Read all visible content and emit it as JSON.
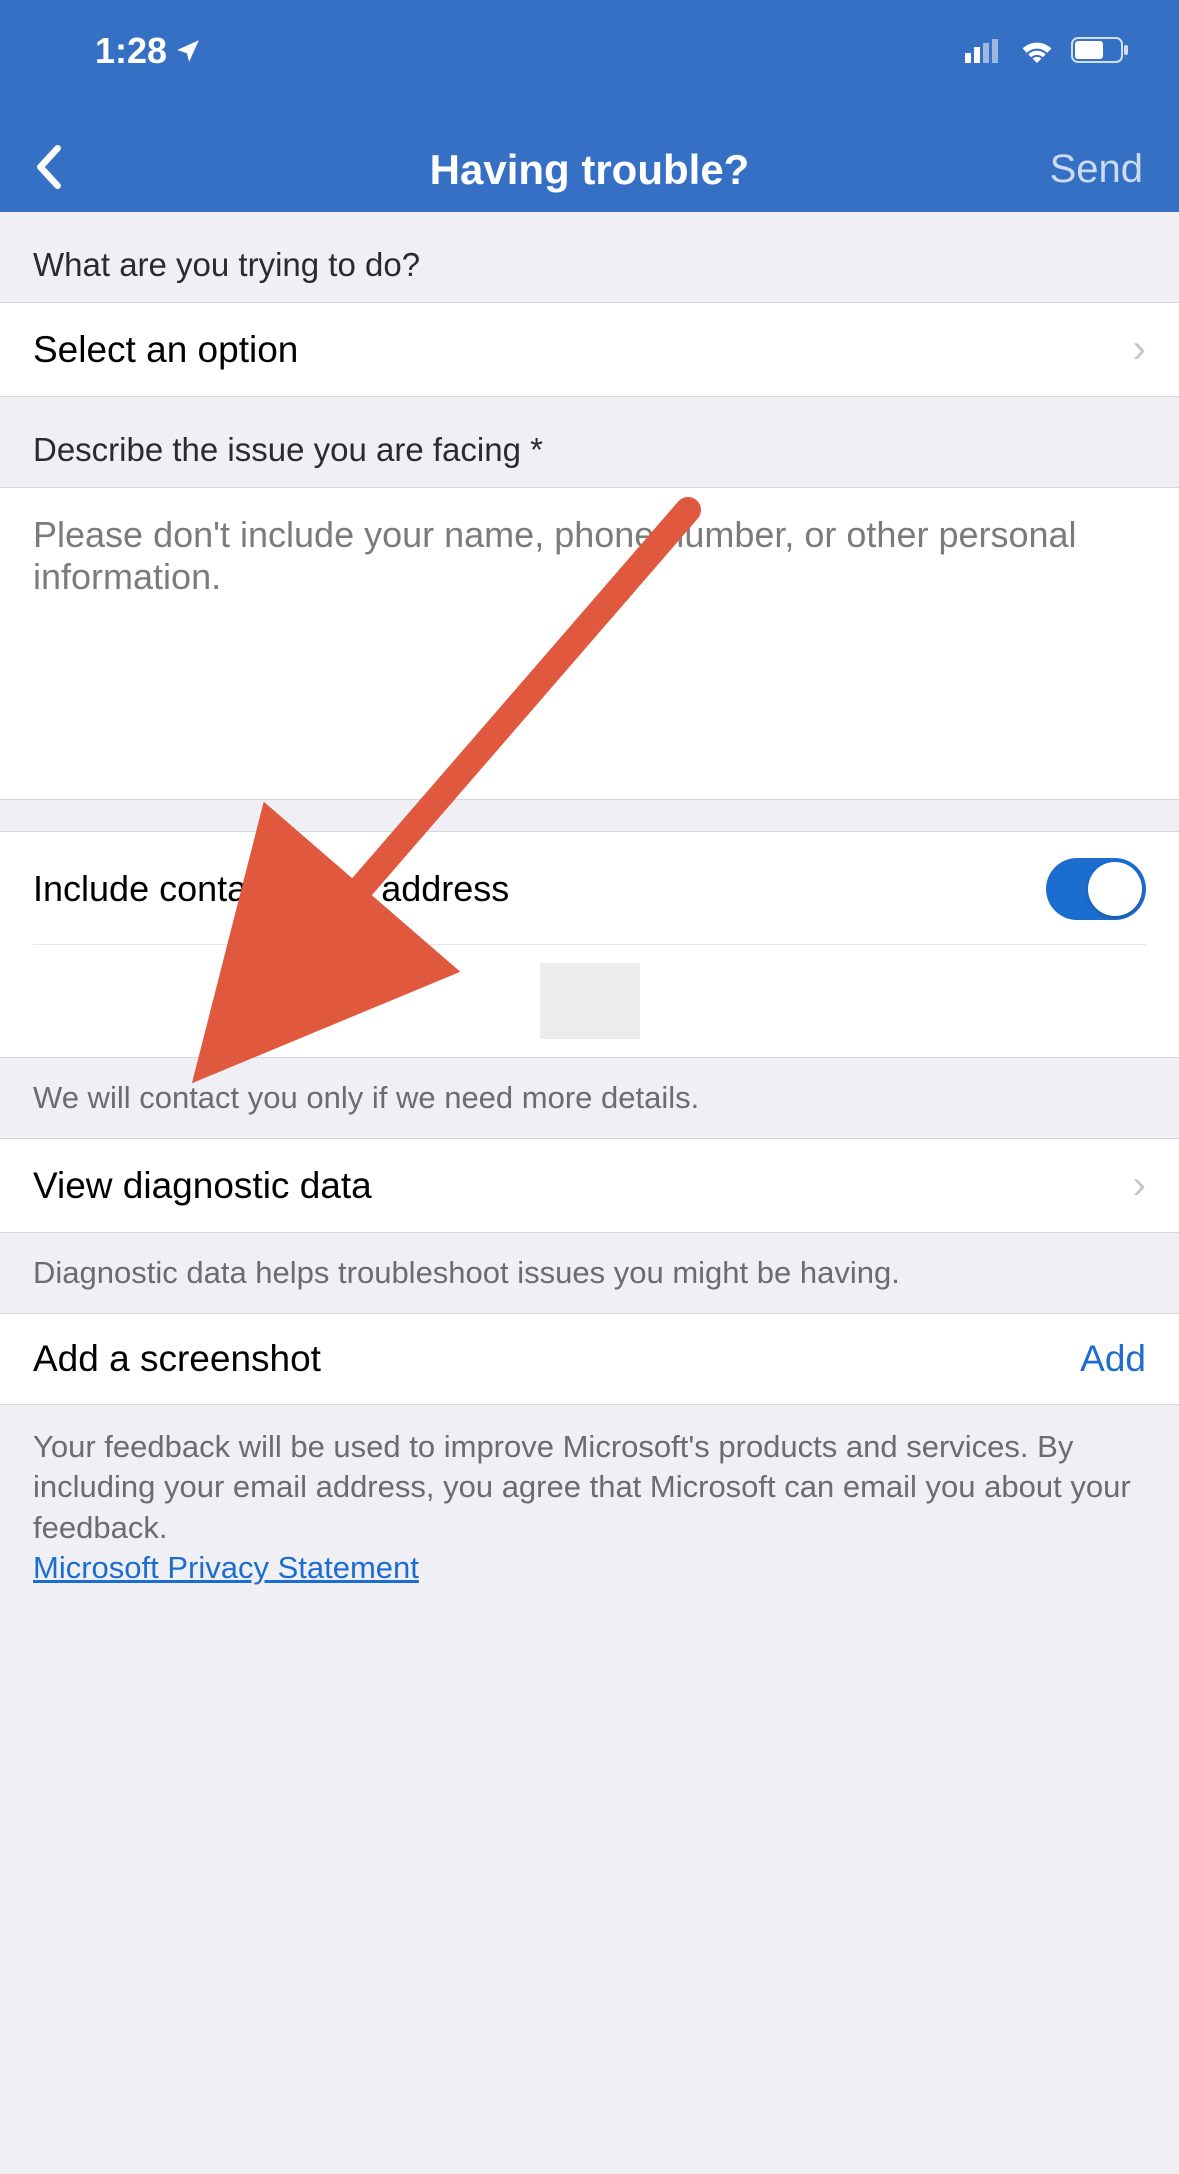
{
  "status": {
    "time": "1:28"
  },
  "nav": {
    "title": "Having trouble?",
    "send": "Send"
  },
  "q1": {
    "label": "What are you trying to do?",
    "value": "Select an option"
  },
  "q2": {
    "label": "Describe the issue you are facing *",
    "placeholder": "Please don't include your name, phone number, or other personal information."
  },
  "email": {
    "label": "Include contact email address",
    "note": "We will contact you only if we need more details."
  },
  "diag": {
    "label": "View diagnostic data",
    "note": "Diagnostic data helps troubleshoot issues you might be having."
  },
  "shot": {
    "label": "Add a screenshot",
    "action": "Add"
  },
  "disclaimer": {
    "text": "Your feedback will be used to improve Microsoft's products and services. By including your email address, you agree that Microsoft can email you about your feedback.",
    "link": "Microsoft Privacy Statement"
  }
}
